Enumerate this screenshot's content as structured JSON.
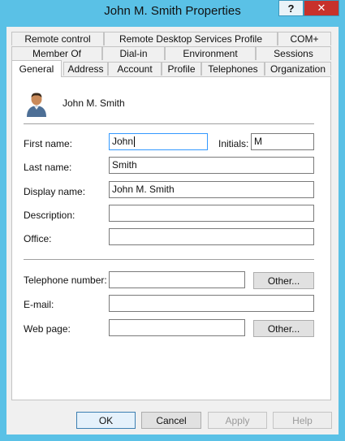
{
  "window": {
    "title": "John M. Smith Properties",
    "help_label": "?",
    "close_label": "✕"
  },
  "tabs": {
    "row1": [
      "Remote control",
      "Remote Desktop Services Profile",
      "COM+"
    ],
    "row2": [
      "Member Of",
      "Dial-in",
      "Environment",
      "Sessions"
    ],
    "row3": [
      "General",
      "Address",
      "Account",
      "Profile",
      "Telephones",
      "Organization"
    ],
    "active": "General"
  },
  "general": {
    "header_name": "John M. Smith",
    "first_name_label": "First name:",
    "first_name_value": "John",
    "initials_label": "Initials:",
    "initials_value": "M",
    "last_name_label": "Last name:",
    "last_name_value": "Smith",
    "display_name_label": "Display name:",
    "display_name_value": "John M. Smith",
    "description_label": "Description:",
    "description_value": "",
    "office_label": "Office:",
    "office_value": "",
    "telephone_label": "Telephone number:",
    "telephone_value": "",
    "telephone_other_label": "Other...",
    "email_label": "E-mail:",
    "email_value": "",
    "webpage_label": "Web page:",
    "webpage_value": "",
    "webpage_other_label": "Other..."
  },
  "footer": {
    "ok_label": "OK",
    "cancel_label": "Cancel",
    "apply_label": "Apply",
    "help_label": "Help"
  },
  "colors": {
    "titlebar": "#5ac1e6",
    "close_button": "#c7312b",
    "focus_border": "#3399ff"
  }
}
